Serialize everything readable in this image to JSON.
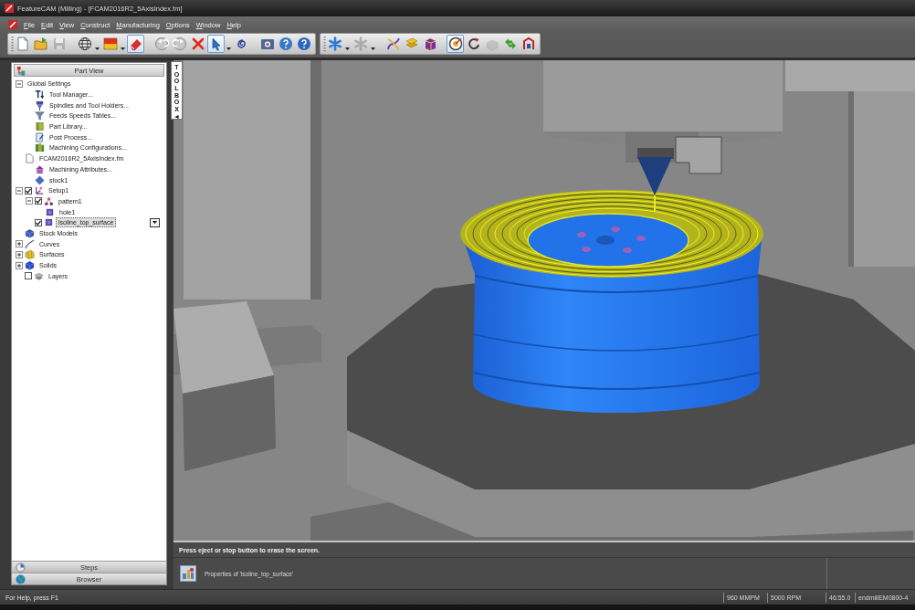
{
  "window": {
    "title": "FeatureCAM (Milling) - [FCAM2016R2_5AxisIndex.fm]"
  },
  "menu": [
    "File",
    "Edit",
    "View",
    "Construct",
    "Manufacturing",
    "Options",
    "Window",
    "Help"
  ],
  "toolbars": [
    {
      "groups": [
        [
          {
            "kind": "new",
            "pressed": false,
            "disabled": false,
            "dropdown": false
          },
          {
            "kind": "open",
            "pressed": false,
            "disabled": false,
            "dropdown": false
          },
          {
            "kind": "save",
            "pressed": false,
            "disabled": true,
            "dropdown": false
          }
        ],
        [
          {
            "kind": "globe",
            "pressed": false,
            "disabled": false,
            "dropdown": true
          },
          {
            "kind": "swatch",
            "pressed": false,
            "disabled": false,
            "dropdown": true
          },
          {
            "kind": "eraser",
            "pressed": true,
            "disabled": false,
            "dropdown": false
          }
        ],
        [
          {
            "kind": "undo",
            "pressed": false,
            "disabled": false,
            "dropdown": false
          },
          {
            "kind": "redo",
            "pressed": false,
            "disabled": false,
            "dropdown": false
          },
          {
            "kind": "delete",
            "pressed": false,
            "disabled": false,
            "dropdown": false
          },
          {
            "kind": "select",
            "pressed": true,
            "disabled": false,
            "dropdown": true
          },
          {
            "kind": "spiral",
            "pressed": false,
            "disabled": false,
            "dropdown": false
          }
        ],
        [
          {
            "kind": "render",
            "pressed": false,
            "disabled": false,
            "dropdown": false
          },
          {
            "kind": "help_topics",
            "pressed": false,
            "disabled": false,
            "dropdown": false
          },
          {
            "kind": "help",
            "pressed": false,
            "disabled": false,
            "dropdown": false
          }
        ]
      ]
    },
    {
      "groups": [
        [
          {
            "kind": "star",
            "pressed": false,
            "disabled": false,
            "dropdown": true
          },
          {
            "kind": "star",
            "pressed": false,
            "disabled": true,
            "dropdown": true
          }
        ],
        [
          {
            "kind": "curve",
            "pressed": false,
            "disabled": false,
            "dropdown": false
          },
          {
            "kind": "stack",
            "pressed": false,
            "disabled": false,
            "dropdown": false
          },
          {
            "kind": "box",
            "pressed": false,
            "disabled": false,
            "dropdown": false
          }
        ],
        [
          {
            "kind": "target",
            "pressed": true,
            "disabled": false,
            "dropdown": false
          },
          {
            "kind": "rotate",
            "pressed": false,
            "disabled": false,
            "dropdown": false
          },
          {
            "kind": "block",
            "pressed": false,
            "disabled": true,
            "dropdown": false
          },
          {
            "kind": "move",
            "pressed": false,
            "disabled": false,
            "dropdown": false
          },
          {
            "kind": "arch",
            "pressed": false,
            "disabled": false,
            "dropdown": false
          }
        ]
      ]
    }
  ],
  "part_view": {
    "title": "Part View",
    "tree": [
      {
        "label": "Global Settings",
        "kind": "group",
        "expanded": true,
        "selected": false,
        "children": [
          {
            "label": "Tool Manager...",
            "kind": "tool",
            "selected": false
          },
          {
            "label": "Spindles and Tool Holders...",
            "kind": "spindle",
            "selected": false
          },
          {
            "label": "Feeds Speeds Tables...",
            "kind": "feeds",
            "selected": false
          },
          {
            "label": "Part Library...",
            "kind": "library",
            "selected": false
          },
          {
            "label": "Post Process...",
            "kind": "post",
            "selected": false
          },
          {
            "label": "Machining Configurations...",
            "kind": "config",
            "selected": false
          }
        ]
      },
      {
        "label": "FCAM2016R2_5AxisIndex.fm",
        "kind": "file",
        "selected": false,
        "children": [
          {
            "label": "Machining Attributes...",
            "kind": "attributes",
            "selected": false
          },
          {
            "label": "stock1",
            "kind": "stock",
            "selected": false
          }
        ]
      },
      {
        "label": "Setup1",
        "kind": "setup",
        "expanded": true,
        "checked": true,
        "selected": false,
        "children": [
          {
            "label": "pattern1",
            "kind": "pattern",
            "expanded": true,
            "checked": true,
            "selected": false,
            "children": [
              {
                "label": "hole1",
                "kind": "feature",
                "selected": false
              }
            ]
          },
          {
            "label": "isoline_top_surface",
            "kind": "feature",
            "checked": true,
            "selected": true,
            "menu_button": true
          }
        ]
      },
      {
        "label": "Stock Models",
        "kind": "models",
        "selected": false
      },
      {
        "label": "Curves",
        "kind": "curves",
        "expanded": false,
        "selected": false
      },
      {
        "label": "Surfaces",
        "kind": "surfaces",
        "expanded": false,
        "selected": false
      },
      {
        "label": "Solids",
        "kind": "solids",
        "expanded": false,
        "selected": false
      },
      {
        "label": "Layers",
        "kind": "layers",
        "checked": false,
        "selected": false
      }
    ],
    "panel_buttons": [
      {
        "kind": "steps",
        "label": "Steps"
      },
      {
        "kind": "browser",
        "label": "Browser"
      }
    ]
  },
  "toolbox": {
    "label": "TOOLBOX",
    "arrow": "◄"
  },
  "message_panel": {
    "message": "Press eject or stop button to erase the screen.",
    "properties": "Properties of 'isoline_top_surface'"
  },
  "status_bar": {
    "help": "For Help, press F1",
    "fields": [
      "960 MMPM",
      "5000 RPM",
      "46:55.0",
      "endmillEM0800-4"
    ]
  }
}
